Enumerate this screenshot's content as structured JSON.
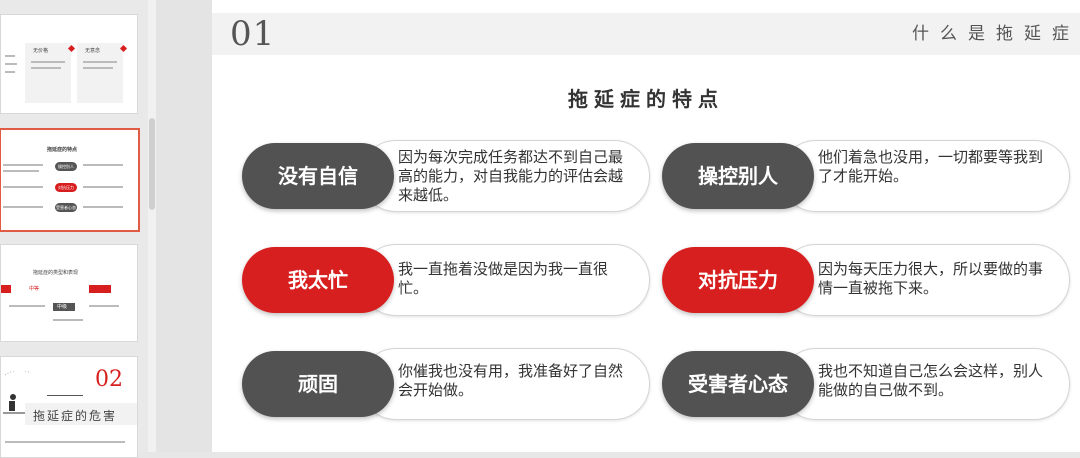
{
  "slide": {
    "number": "01",
    "section_title": "什么是拖延症",
    "main_title": "拖延症的特点",
    "cards": [
      {
        "label": "没有自信",
        "text": "因为每次完成任务都达不到自己最高的能力，对自我能力的评估会越来越低。",
        "style": "dark"
      },
      {
        "label": "操控别人",
        "text": "他们着急也没用，一切都要等我到了才能开始。",
        "style": "dark"
      },
      {
        "label": "我太忙",
        "text": "我一直拖着没做是因为我一直很忙。",
        "style": "red"
      },
      {
        "label": "对抗压力",
        "text": "因为每天压力很大，所以要做的事情一直被拖下来。",
        "style": "red"
      },
      {
        "label": "顽固",
        "text": "你催我也没有用，我准备好了自然会开始做。",
        "style": "dark"
      },
      {
        "label": "受害者心态",
        "text": "我也不知道自己怎么会这样，别人能做的自己做不到。",
        "style": "dark"
      }
    ]
  },
  "thumbnails": {
    "thumb1": {
      "heading_a": "无价格",
      "heading_b": "无意念"
    },
    "thumb2": {
      "heading": "拖延症的特点",
      "chips": [
        "操控别人",
        "对抗压力",
        "受害者心态"
      ]
    },
    "thumb3": {
      "heading": "拖延症的类型和表现",
      "tags": [
        "中等",
        "中级"
      ]
    },
    "thumb4": {
      "number": "02",
      "title": "拖延症的危害"
    }
  },
  "colors": {
    "accent_red": "#d81f1f",
    "dark_pill": "#525252",
    "thumb_selected_border": "#e25b45"
  }
}
